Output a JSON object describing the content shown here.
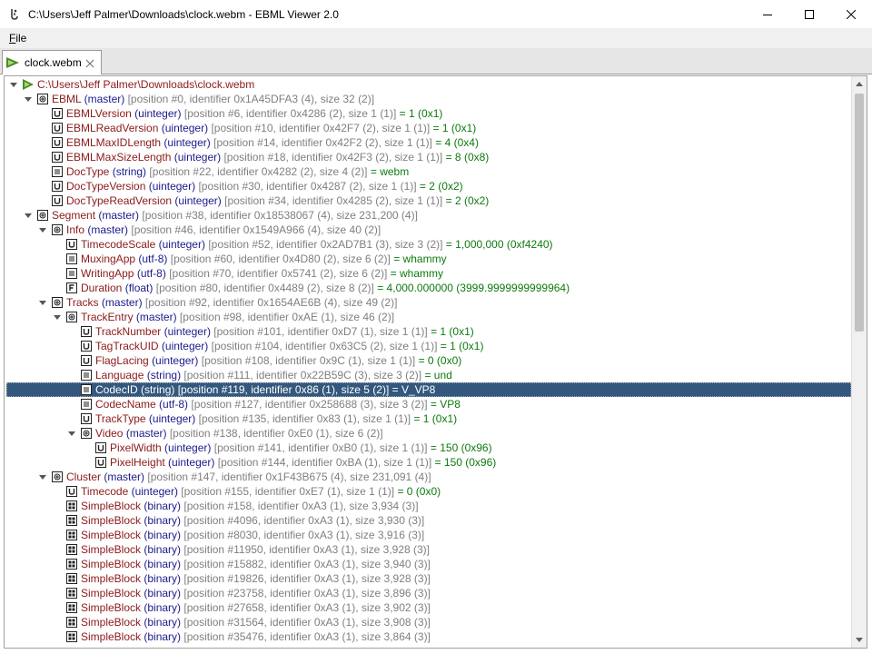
{
  "window": {
    "title": "C:\\Users\\Jeff Palmer\\Downloads\\clock.webm - EBML Viewer 2.0"
  },
  "menu": {
    "items": [
      {
        "label": "File",
        "mnemonic": "F",
        "rest": "ile"
      }
    ]
  },
  "tabs": [
    {
      "label": "clock.webm"
    }
  ],
  "colors": {
    "element_name": "#8b1a1a",
    "element_type": "#1a1a8b",
    "meta": "#7f7f7f",
    "value": "#0f7a0f",
    "selection": "#34587d"
  },
  "tree": {
    "selected_index": 21,
    "rows": [
      {
        "depth": 0,
        "toggle": "expanded",
        "icon": "file",
        "name": "C:\\Users\\Jeff Palmer\\Downloads\\clock.webm",
        "type": "",
        "meta": "",
        "value": ""
      },
      {
        "depth": 1,
        "toggle": "expanded",
        "icon": "master",
        "name": "EBML",
        "type": "(master)",
        "meta": "[position #0, identifier 0x1A45DFA3 (4), size 32 (2)]",
        "value": ""
      },
      {
        "depth": 2,
        "toggle": "",
        "icon": "uint",
        "name": "EBMLVersion",
        "type": "(uinteger)",
        "meta": "[position #6, identifier 0x4286 (2), size 1 (1)]",
        "value": "= 1 (0x1)"
      },
      {
        "depth": 2,
        "toggle": "",
        "icon": "uint",
        "name": "EBMLReadVersion",
        "type": "(uinteger)",
        "meta": "[position #10, identifier 0x42F7 (2), size 1 (1)]",
        "value": "= 1 (0x1)"
      },
      {
        "depth": 2,
        "toggle": "",
        "icon": "uint",
        "name": "EBMLMaxIDLength",
        "type": "(uinteger)",
        "meta": "[position #14, identifier 0x42F2 (2), size 1 (1)]",
        "value": "= 4 (0x4)"
      },
      {
        "depth": 2,
        "toggle": "",
        "icon": "uint",
        "name": "EBMLMaxSizeLength",
        "type": "(uinteger)",
        "meta": "[position #18, identifier 0x42F3 (2), size 1 (1)]",
        "value": "= 8 (0x8)"
      },
      {
        "depth": 2,
        "toggle": "",
        "icon": "string",
        "name": "DocType",
        "type": "(string)",
        "meta": "[position #22, identifier 0x4282 (2), size 4 (2)]",
        "value": "= webm"
      },
      {
        "depth": 2,
        "toggle": "",
        "icon": "uint",
        "name": "DocTypeVersion",
        "type": "(uinteger)",
        "meta": "[position #30, identifier 0x4287 (2), size 1 (1)]",
        "value": "= 2 (0x2)"
      },
      {
        "depth": 2,
        "toggle": "",
        "icon": "uint",
        "name": "DocTypeReadVersion",
        "type": "(uinteger)",
        "meta": "[position #34, identifier 0x4285 (2), size 1 (1)]",
        "value": "= 2 (0x2)"
      },
      {
        "depth": 1,
        "toggle": "expanded",
        "icon": "master",
        "name": "Segment",
        "type": "(master)",
        "meta": "[position #38, identifier 0x18538067 (4), size 231,200 (4)]",
        "value": ""
      },
      {
        "depth": 2,
        "toggle": "expanded",
        "icon": "master",
        "name": "Info",
        "type": "(master)",
        "meta": "[position #46, identifier 0x1549A966 (4), size 40 (2)]",
        "value": ""
      },
      {
        "depth": 3,
        "toggle": "",
        "icon": "uint",
        "name": "TimecodeScale",
        "type": "(uinteger)",
        "meta": "[position #52, identifier 0x2AD7B1 (3), size 3 (2)]",
        "value": "= 1,000,000 (0xf4240)"
      },
      {
        "depth": 3,
        "toggle": "",
        "icon": "string",
        "name": "MuxingApp",
        "type": "(utf-8)",
        "meta": "[position #60, identifier 0x4D80 (2), size 6 (2)]",
        "value": "= whammy"
      },
      {
        "depth": 3,
        "toggle": "",
        "icon": "string",
        "name": "WritingApp",
        "type": "(utf-8)",
        "meta": "[position #70, identifier 0x5741 (2), size 6 (2)]",
        "value": "= whammy"
      },
      {
        "depth": 3,
        "toggle": "",
        "icon": "float",
        "name": "Duration",
        "type": "(float)",
        "meta": "[position #80, identifier 0x4489 (2), size 8 (2)]",
        "value": "= 4,000.000000 (3999.9999999999964)"
      },
      {
        "depth": 2,
        "toggle": "expanded",
        "icon": "master",
        "name": "Tracks",
        "type": "(master)",
        "meta": "[position #92, identifier 0x1654AE6B (4), size 49 (2)]",
        "value": ""
      },
      {
        "depth": 3,
        "toggle": "expanded",
        "icon": "master",
        "name": "TrackEntry",
        "type": "(master)",
        "meta": "[position #98, identifier 0xAE (1), size 46 (2)]",
        "value": ""
      },
      {
        "depth": 4,
        "toggle": "",
        "icon": "uint",
        "name": "TrackNumber",
        "type": "(uinteger)",
        "meta": "[position #101, identifier 0xD7 (1), size 1 (1)]",
        "value": "= 1 (0x1)"
      },
      {
        "depth": 4,
        "toggle": "",
        "icon": "uint",
        "name": "TagTrackUID",
        "type": "(uinteger)",
        "meta": "[position #104, identifier 0x63C5 (2), size 1 (1)]",
        "value": "= 1 (0x1)"
      },
      {
        "depth": 4,
        "toggle": "",
        "icon": "uint",
        "name": "FlagLacing",
        "type": "(uinteger)",
        "meta": "[position #108, identifier 0x9C (1), size 1 (1)]",
        "value": "= 0 (0x0)"
      },
      {
        "depth": 4,
        "toggle": "",
        "icon": "string",
        "name": "Language",
        "type": "(string)",
        "meta": "[position #111, identifier 0x22B59C (3), size 3 (2)]",
        "value": "= und"
      },
      {
        "depth": 4,
        "toggle": "",
        "icon": "string",
        "name": "CodecID",
        "type": "(string)",
        "meta": "[position #119, identifier 0x86 (1), size 5 (2)]",
        "value": "= V_VP8"
      },
      {
        "depth": 4,
        "toggle": "",
        "icon": "string",
        "name": "CodecName",
        "type": "(utf-8)",
        "meta": "[position #127, identifier 0x258688 (3), size 3 (2)]",
        "value": "= VP8"
      },
      {
        "depth": 4,
        "toggle": "",
        "icon": "uint",
        "name": "TrackType",
        "type": "(uinteger)",
        "meta": "[position #135, identifier 0x83 (1), size 1 (1)]",
        "value": "= 1 (0x1)"
      },
      {
        "depth": 4,
        "toggle": "expanded",
        "icon": "master",
        "name": "Video",
        "type": "(master)",
        "meta": "[position #138, identifier 0xE0 (1), size 6 (2)]",
        "value": ""
      },
      {
        "depth": 5,
        "toggle": "",
        "icon": "uint",
        "name": "PixelWidth",
        "type": "(uinteger)",
        "meta": "[position #141, identifier 0xB0 (1), size 1 (1)]",
        "value": "= 150 (0x96)"
      },
      {
        "depth": 5,
        "toggle": "",
        "icon": "uint",
        "name": "PixelHeight",
        "type": "(uinteger)",
        "meta": "[position #144, identifier 0xBA (1), size 1 (1)]",
        "value": "= 150 (0x96)"
      },
      {
        "depth": 2,
        "toggle": "expanded",
        "icon": "master",
        "name": "Cluster",
        "type": "(master)",
        "meta": "[position #147, identifier 0x1F43B675 (4), size 231,091 (4)]",
        "value": ""
      },
      {
        "depth": 3,
        "toggle": "",
        "icon": "uint",
        "name": "Timecode",
        "type": "(uinteger)",
        "meta": "[position #155, identifier 0xE7 (1), size 1 (1)]",
        "value": "= 0 (0x0)"
      },
      {
        "depth": 3,
        "toggle": "",
        "icon": "binary",
        "name": "SimpleBlock",
        "type": "(binary)",
        "meta": "[position #158, identifier 0xA3 (1), size 3,934 (3)]",
        "value": ""
      },
      {
        "depth": 3,
        "toggle": "",
        "icon": "binary",
        "name": "SimpleBlock",
        "type": "(binary)",
        "meta": "[position #4096, identifier 0xA3 (1), size 3,930 (3)]",
        "value": ""
      },
      {
        "depth": 3,
        "toggle": "",
        "icon": "binary",
        "name": "SimpleBlock",
        "type": "(binary)",
        "meta": "[position #8030, identifier 0xA3 (1), size 3,916 (3)]",
        "value": ""
      },
      {
        "depth": 3,
        "toggle": "",
        "icon": "binary",
        "name": "SimpleBlock",
        "type": "(binary)",
        "meta": "[position #11950, identifier 0xA3 (1), size 3,928 (3)]",
        "value": ""
      },
      {
        "depth": 3,
        "toggle": "",
        "icon": "binary",
        "name": "SimpleBlock",
        "type": "(binary)",
        "meta": "[position #15882, identifier 0xA3 (1), size 3,940 (3)]",
        "value": ""
      },
      {
        "depth": 3,
        "toggle": "",
        "icon": "binary",
        "name": "SimpleBlock",
        "type": "(binary)",
        "meta": "[position #19826, identifier 0xA3 (1), size 3,928 (3)]",
        "value": ""
      },
      {
        "depth": 3,
        "toggle": "",
        "icon": "binary",
        "name": "SimpleBlock",
        "type": "(binary)",
        "meta": "[position #23758, identifier 0xA3 (1), size 3,896 (3)]",
        "value": ""
      },
      {
        "depth": 3,
        "toggle": "",
        "icon": "binary",
        "name": "SimpleBlock",
        "type": "(binary)",
        "meta": "[position #27658, identifier 0xA3 (1), size 3,902 (3)]",
        "value": ""
      },
      {
        "depth": 3,
        "toggle": "",
        "icon": "binary",
        "name": "SimpleBlock",
        "type": "(binary)",
        "meta": "[position #31564, identifier 0xA3 (1), size 3,908 (3)]",
        "value": ""
      },
      {
        "depth": 3,
        "toggle": "",
        "icon": "binary",
        "name": "SimpleBlock",
        "type": "(binary)",
        "meta": "[position #35476, identifier 0xA3 (1), size 3,864 (3)]",
        "value": ""
      }
    ]
  },
  "scrollbar": {
    "scroll_fraction": 0.0,
    "visible_fraction": 0.44
  }
}
